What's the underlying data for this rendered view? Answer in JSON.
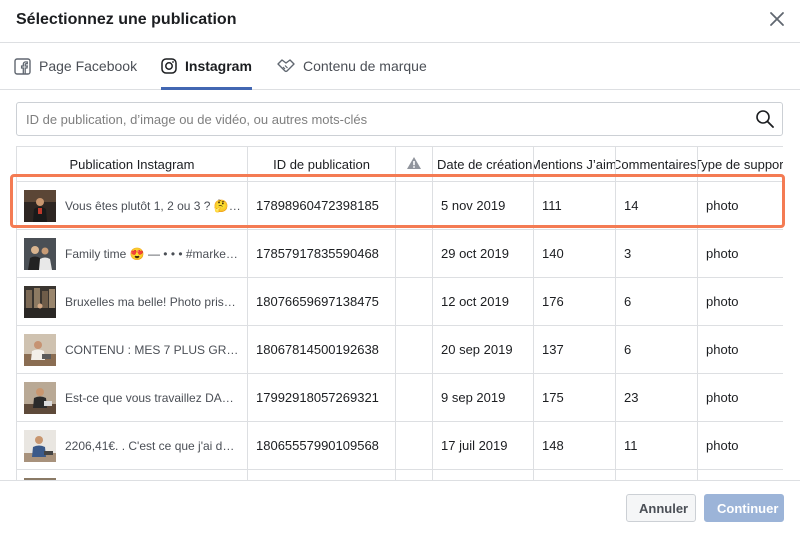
{
  "dialog": {
    "title": "Sélectionnez une publication"
  },
  "tabs": [
    {
      "label": "Page Facebook",
      "icon": "facebook-icon",
      "active": false
    },
    {
      "label": "Instagram",
      "icon": "instagram-icon",
      "active": true
    },
    {
      "label": "Contenu de marque",
      "icon": "handshake-icon",
      "active": false
    }
  ],
  "search": {
    "placeholder": "ID de publication, d’image ou de vidéo, ou autres mots-clés",
    "value": ""
  },
  "table": {
    "headers": [
      "Publication Instagram",
      "ID de publication",
      "",
      "Date de création",
      "Mentions J’aime",
      "Commentaires",
      "Type de support"
    ],
    "rows": [
      {
        "caption": "Vous êtes plutôt 1, 2 ou 3 ? 🤔 . ...",
        "id": "17898960472398185",
        "date": "5 nov 2019",
        "likes": "111",
        "comments": "14",
        "type": "photo"
      },
      {
        "caption": "Family time 😍 — • • • #marketin...",
        "id": "17857917835590468",
        "date": "29 oct 2019",
        "likes": "140",
        "comments": "3",
        "type": "photo"
      },
      {
        "caption": "Bruxelles ma belle! Photo prise p...",
        "id": "18076659697138475",
        "date": "12 oct 2019",
        "likes": "176",
        "comments": "6",
        "type": "photo"
      },
      {
        "caption": "CONTENU : MES 7 PLUS GRAND...",
        "id": "18067814500192638",
        "date": "20 sep 2019",
        "likes": "137",
        "comments": "6",
        "type": "photo"
      },
      {
        "caption": "Est-ce que vous travaillez DANS ...",
        "id": "17992918057269321",
        "date": "9 sep 2019",
        "likes": "175",
        "comments": "23",
        "type": "photo"
      },
      {
        "caption": "2206,41€. . C'est ce que j'ai dép...",
        "id": "18065557990109568",
        "date": "17 juil 2019",
        "likes": "148",
        "comments": "11",
        "type": "photo"
      }
    ]
  },
  "footer": {
    "cancel_label": "Annuler",
    "continue_label": "Continuer"
  },
  "colors": {
    "accent": "#4267b2",
    "highlight": "#f47b53",
    "continue_disabled": "#9cb4d8"
  }
}
